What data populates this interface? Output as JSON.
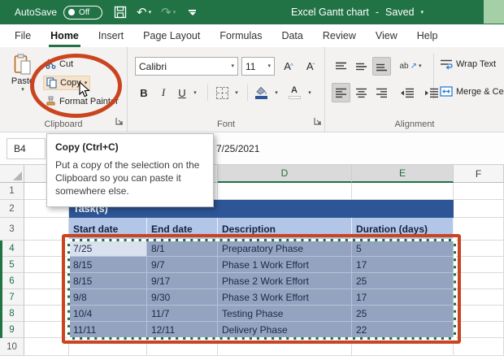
{
  "titlebar": {
    "autosave_label": "AutoSave",
    "autosave_state": "Off",
    "doc_title": "Excel Gantt chart",
    "separator": "-",
    "save_status": "Saved"
  },
  "tabs": [
    {
      "label": "File"
    },
    {
      "label": "Home"
    },
    {
      "label": "Insert"
    },
    {
      "label": "Page Layout"
    },
    {
      "label": "Formulas"
    },
    {
      "label": "Data"
    },
    {
      "label": "Review"
    },
    {
      "label": "View"
    },
    {
      "label": "Help"
    }
  ],
  "ribbon": {
    "clipboard": {
      "label": "Clipboard",
      "paste": "Paste",
      "cut": "Cut",
      "copy": "Copy",
      "format_painter": "Format Painter"
    },
    "font": {
      "label": "Font",
      "font_name": "Calibri",
      "font_size": "11",
      "bold": "B",
      "italic": "I",
      "underline": "U",
      "grow_a": "A",
      "shrink_a": "A",
      "color_a": "A"
    },
    "alignment": {
      "label": "Alignment",
      "orientation_ab": "ab",
      "wrap_text": "Wrap Text",
      "merge_center": "Merge & Center"
    }
  },
  "formula_bar": {
    "name_box": "B4",
    "value": "7/25/2021"
  },
  "tooltip": {
    "title": "Copy (Ctrl+C)",
    "body": "Put a copy of the selection on the Clipboard so you can paste it somewhere else."
  },
  "sheet": {
    "cols": [
      "",
      "",
      "",
      "D",
      "E",
      "F"
    ],
    "rows": [
      "1",
      "2",
      "3",
      "4",
      "5",
      "6",
      "7",
      "8",
      "9",
      "10"
    ],
    "table": {
      "title": "Task(s)",
      "headers": [
        "Start date",
        "End date",
        "Description",
        "Duration (days)"
      ],
      "data": [
        {
          "start": "7/25",
          "end": "8/1",
          "desc": "Preparatory Phase",
          "dur": "5"
        },
        {
          "start": "8/15",
          "end": "9/7",
          "desc": "Phase 1 Work Effort",
          "dur": "17"
        },
        {
          "start": "8/15",
          "end": "9/17",
          "desc": "Phase 2 Work Effort",
          "dur": "25"
        },
        {
          "start": "9/8",
          "end": "9/30",
          "desc": "Phase 3 Work Effort",
          "dur": "17"
        },
        {
          "start": "10/4",
          "end": "11/7",
          "desc": "Testing Phase",
          "dur": "25"
        },
        {
          "start": "11/11",
          "end": "12/11",
          "desc": "Delivery Phase",
          "dur": "22"
        }
      ]
    }
  },
  "colors": {
    "excel_green": "#217346",
    "task_header_bg": "#2e5696",
    "column_header_bg": "#b4c6e7",
    "selection_fill": "#94a3c0",
    "active_cell_fill": "#d9e0ee",
    "annotation_red": "#c9441f",
    "marching_ants_green": "#1d6f42"
  }
}
